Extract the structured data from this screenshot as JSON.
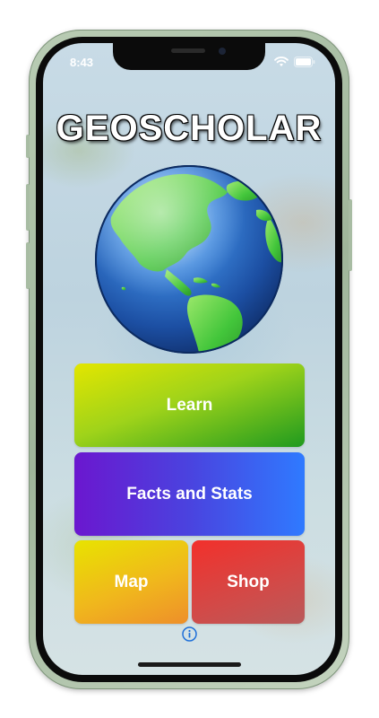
{
  "status_bar": {
    "time": "8:43"
  },
  "app": {
    "title": "GEOSCHOLAR"
  },
  "menu": {
    "learn": "Learn",
    "facts": "Facts and Stats",
    "map": "Map",
    "shop": "Shop"
  },
  "icons": {
    "wifi": "wifi-icon",
    "battery": "battery-icon",
    "info": "info-icon",
    "globe": "globe-icon"
  },
  "colors": {
    "learn": "#9fd31a",
    "facts": "#4a43df",
    "map": "#f0b81c",
    "shop": "#d24a48",
    "info": "#1e6fd9"
  }
}
